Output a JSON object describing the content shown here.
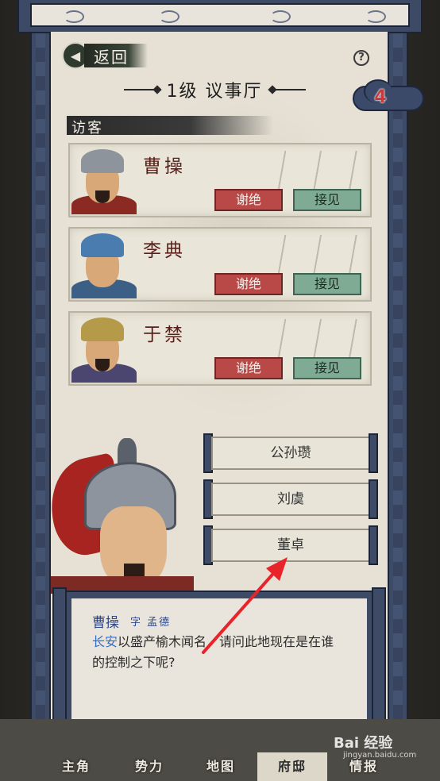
{
  "header": {
    "back_label": "返回",
    "title": "1级 议事厅",
    "badge_count": "4",
    "help_icon": "question-circle-icon"
  },
  "visitors_section": {
    "label": "访客",
    "visitors": [
      {
        "name": "曹操",
        "decline_label": "谢绝",
        "accept_label": "接见"
      },
      {
        "name": "李典",
        "decline_label": "谢绝",
        "accept_label": "接见"
      },
      {
        "name": "于禁",
        "decline_label": "谢绝",
        "accept_label": "接见"
      }
    ]
  },
  "answer_choices": [
    "公孙瓒",
    "刘虞",
    "董卓"
  ],
  "dialog": {
    "speaker": "曹操",
    "courtesy_name": "字 孟德",
    "place": "长安",
    "question_rest": "以盛产榆木闻名，请问此地现在是在谁的控制之下呢?"
  },
  "tabs": [
    "主角",
    "势力",
    "地图",
    "府邸",
    "情报"
  ],
  "active_tab": "府邸",
  "watermark": {
    "text": "Bai 经验",
    "sub": "jingyan.baidu.com"
  },
  "colors": {
    "decline": "#b84946",
    "accept": "#7fab94",
    "scroll_rod": "#3d4b66",
    "place_link": "#2f6ed0",
    "speaker": "#2f4a8c",
    "arrow": "#e8242a"
  }
}
